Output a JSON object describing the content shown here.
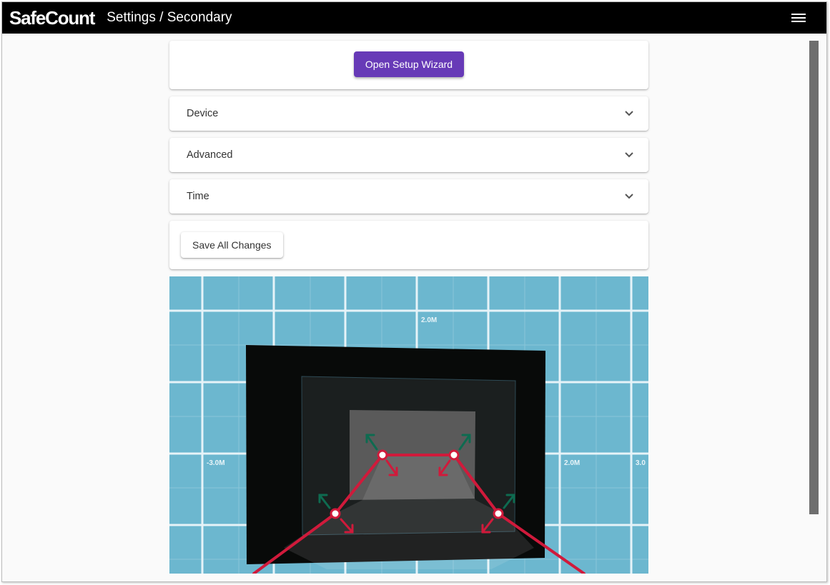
{
  "app": {
    "brand": "SafeCount",
    "page_title": "Settings / Secondary",
    "menu_icon": "hamburger-menu-icon"
  },
  "wizard": {
    "button_label": "Open Setup Wizard",
    "accent_color": "#673ab7"
  },
  "panels": [
    {
      "label": "Device",
      "expanded": false
    },
    {
      "label": "Advanced",
      "expanded": false
    },
    {
      "label": "Time",
      "expanded": false
    }
  ],
  "actions": {
    "save_label": "Save All Changes"
  },
  "visualizer": {
    "axis_labels": {
      "top": "2.0M",
      "left": "-3.0M",
      "right": "2.0M",
      "far_right": "3.0"
    },
    "line_color": "#d01a3b",
    "handle_color": "#0e6b50",
    "grid_background": "#6cb7cf"
  }
}
